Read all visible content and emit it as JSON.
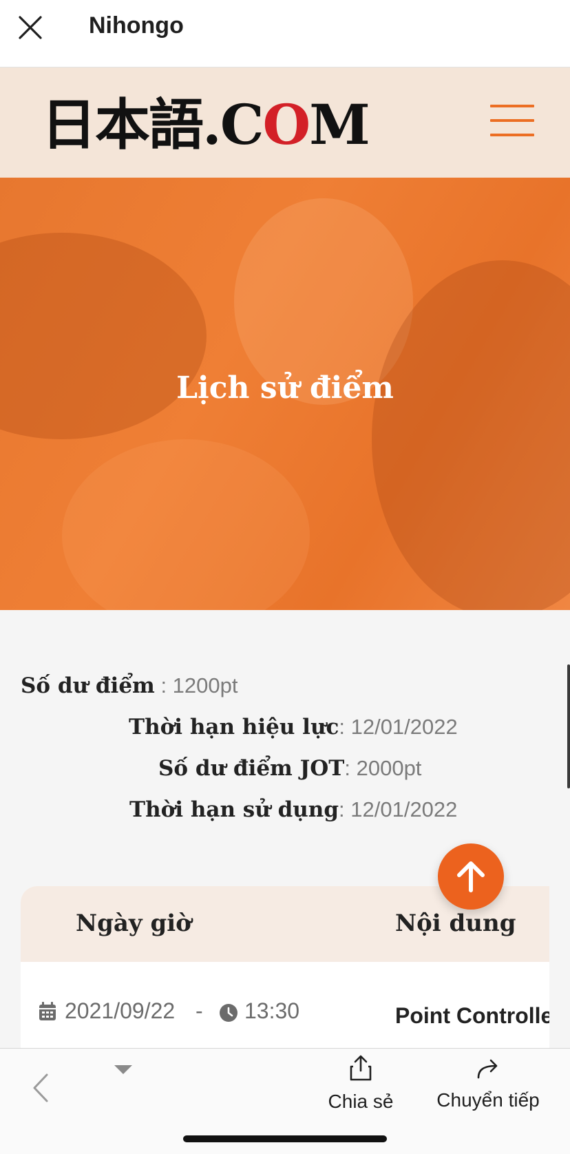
{
  "appbar": {
    "title": "Nihongo",
    "close_icon": "close-icon"
  },
  "site": {
    "logo_prefix": "日本語.C",
    "logo_o": "O",
    "logo_suffix": "M",
    "menu_icon": "hamburger-icon"
  },
  "hero": {
    "title": "Lịch sử điểm"
  },
  "points": {
    "balance_label": "Số dư điểm",
    "balance_value": " : 1200pt",
    "validity_label": "Thời hạn hiệu lực",
    "validity_value": ": 12/01/2022",
    "jot_label": "Số dư điểm JOT",
    "jot_value": ": 2000pt",
    "usage_label": "Thời hạn sử dụng",
    "usage_value": ": 12/01/2022"
  },
  "table": {
    "headers": [
      "Ngày giờ",
      "Nội dung"
    ],
    "rows": [
      {
        "date": "2021/09/22",
        "separator": "-",
        "time": "13:30",
        "content": "Point Controlle"
      }
    ]
  },
  "toolbar": {
    "share_label": "Chia sẻ",
    "forward_label": "Chuyển tiếp"
  },
  "colors": {
    "accent": "#ec621e",
    "header_bg": "#f4e5d8"
  }
}
